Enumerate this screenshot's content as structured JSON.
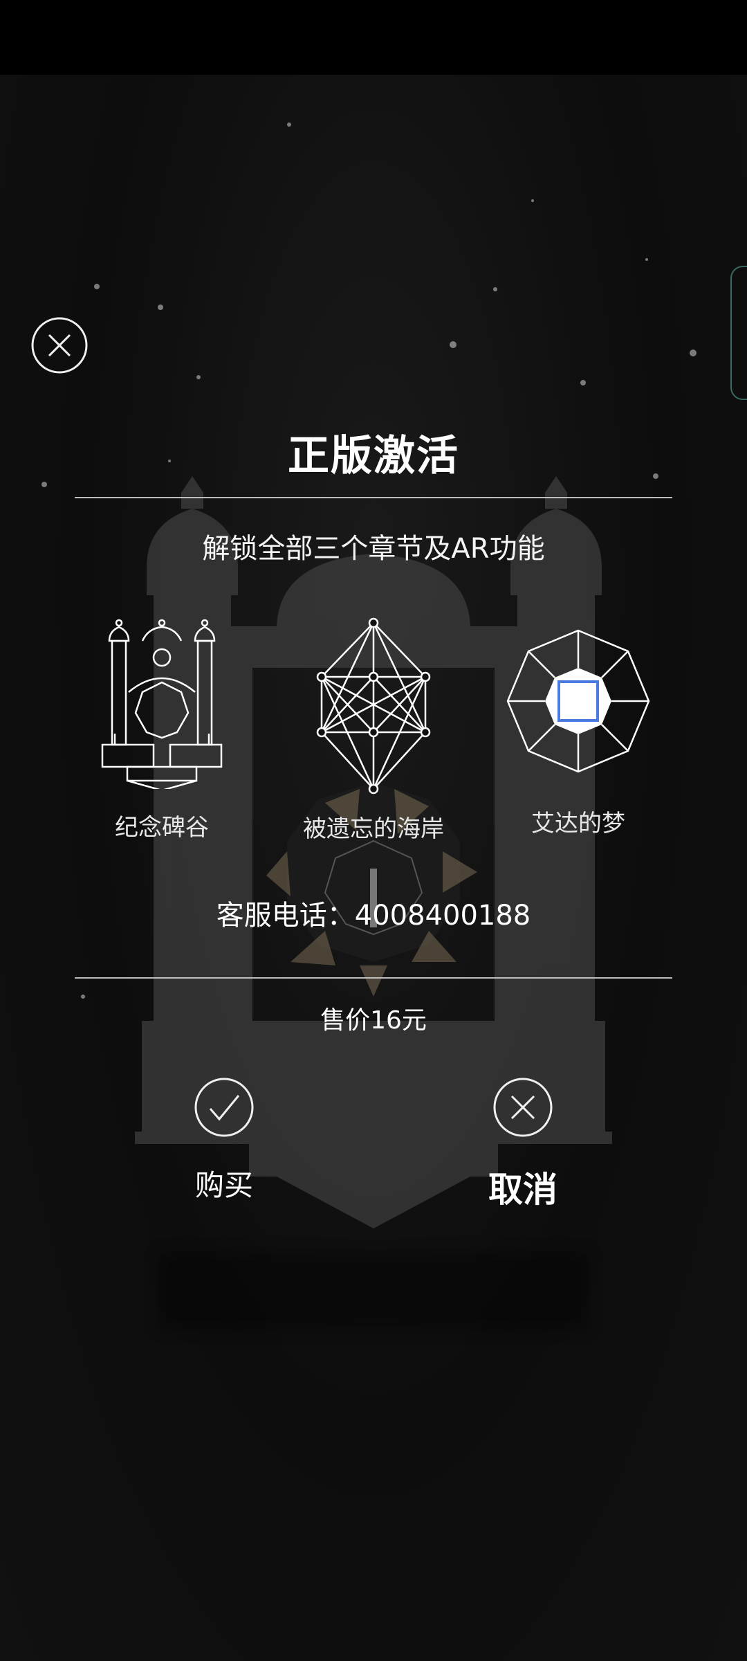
{
  "dialog": {
    "title": "正版激活",
    "subtitle": "解锁全部三个章节及AR功能",
    "support": "客服电话：4008400188",
    "price": "售价16元"
  },
  "chapters": [
    {
      "label": "纪念碑谷",
      "icon": "monument-valley-icon"
    },
    {
      "label": "被遗忘的海岸",
      "icon": "forgotten-shores-icon"
    },
    {
      "label": "艾达的梦",
      "icon": "idas-dream-icon"
    }
  ],
  "actions": {
    "buy_label": "购买",
    "cancel_label": "取消"
  },
  "icons": {
    "close": "close-icon",
    "confirm": "checkmark-icon",
    "cancel": "cancel-icon"
  },
  "colors": {
    "background": "#0e0e0e",
    "text": "#ffffff",
    "accent_blue": "#4a7be0",
    "side_tab_border": "#3a6b62"
  }
}
